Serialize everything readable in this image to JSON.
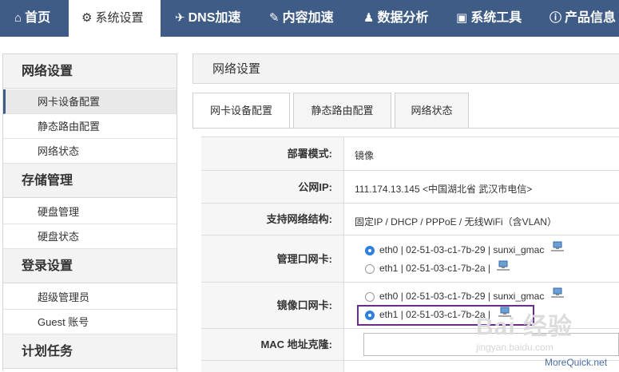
{
  "nav": {
    "items": [
      {
        "icon": "home-icon",
        "glyph": "⌂",
        "label": "首页"
      },
      {
        "icon": "gear-icon",
        "glyph": "⚙",
        "label": "系统设置"
      },
      {
        "icon": "send-icon",
        "glyph": "✈",
        "label": "DNS加速"
      },
      {
        "icon": "edit-icon",
        "glyph": "✎",
        "label": "内容加速"
      },
      {
        "icon": "user-chart-icon",
        "glyph": "♟",
        "label": "数据分析"
      },
      {
        "icon": "briefcase-icon",
        "glyph": "▣",
        "label": "系统工具"
      },
      {
        "icon": "info-icon",
        "glyph": "ⓘ",
        "label": "产品信息"
      }
    ],
    "active_index": 1
  },
  "sidebar": {
    "groups": [
      {
        "label": "网络设置",
        "items": [
          "网卡设备配置",
          "静态路由配置",
          "网络状态"
        ]
      },
      {
        "label": "存储管理",
        "items": [
          "硬盘管理",
          "硬盘状态"
        ]
      },
      {
        "label": "登录设置",
        "items": [
          "超级管理员",
          "Guest 账号"
        ]
      },
      {
        "label": "计划任务",
        "items": []
      }
    ],
    "active_item": "网卡设备配置"
  },
  "panel": {
    "title": "网络设置"
  },
  "tabs": {
    "items": [
      "网卡设备配置",
      "静态路由配置",
      "网络状态"
    ],
    "active_index": 0
  },
  "form": {
    "deploy_mode": {
      "label": "部署模式:",
      "value": "镜像"
    },
    "public_ip": {
      "label": "公网IP:",
      "value": "111.174.13.145 <中国湖北省 武汉市电信>"
    },
    "network_structure": {
      "label": "支持网络结构:",
      "value": "固定IP / DHCP / PPPoE / 无线WiFi（含VLAN）"
    },
    "mgmt_nic": {
      "label": "管理口网卡:",
      "options": [
        {
          "text": "eth0 | 02-51-03-c1-7b-29 | sunxi_gmac",
          "selected": true
        },
        {
          "text": "eth1 | 02-51-03-c1-7b-2a |",
          "selected": false
        }
      ]
    },
    "mirror_nic": {
      "label": "镜像口网卡:",
      "options": [
        {
          "text": "eth0 | 02-51-03-c1-7b-29 | sunxi_gmac",
          "selected": false
        },
        {
          "text": "eth1 | 02-51-03-c1-7b-2a |",
          "selected": true
        }
      ]
    },
    "mac_clone": {
      "label": "MAC 地址克隆:",
      "value": ""
    }
  },
  "watermark": {
    "brand": "Bai 经验",
    "url": "jingyan.baidu.com",
    "corner": "MoreQuick.net"
  },
  "colors": {
    "nav_bg": "#3f5c87",
    "radio_on": "#2d7fe0",
    "highlight": "#6a2d8f"
  }
}
